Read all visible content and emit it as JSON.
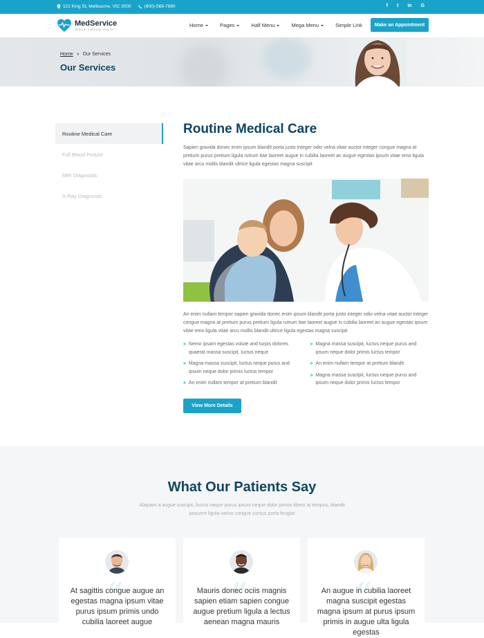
{
  "topbar": {
    "address": "121 King St, Melbourne, VIC 3000",
    "phone": "(800)-569-7890",
    "social": [
      "f",
      "t",
      "in",
      "G"
    ]
  },
  "logo": {
    "name": "MedService",
    "tagline": "MEDICAL & MEDICAL HEALTH"
  },
  "nav": {
    "items": [
      {
        "label": "Home",
        "dropdown": true
      },
      {
        "label": "Pages",
        "dropdown": true
      },
      {
        "label": "Half Menu",
        "dropdown": true
      },
      {
        "label": "Mega Menu",
        "dropdown": true
      },
      {
        "label": "Simple Link",
        "dropdown": false
      }
    ],
    "cta": "Make an Appointment"
  },
  "banner": {
    "breadcrumb_home": "Home",
    "breadcrumb_sep": "»",
    "breadcrumb_current": "Our Services",
    "title": "Our Services"
  },
  "sidebar": {
    "items": [
      {
        "label": "Routine Medical Care",
        "active": true
      },
      {
        "label": "Full Blood Picture",
        "active": false
      },
      {
        "label": "MRI Diagnostic",
        "active": false
      },
      {
        "label": "X-Ray Diagnostic",
        "active": false
      }
    ]
  },
  "service": {
    "title": "Routine Medical Care",
    "intro": "Sapien gravida donec enim ipsum blandit porta justo integer odio velna vitae auctor integer congue magna at pretium purus pretium ligula rutrum itae laoreet augue in cubilia laoreet an augue egestas ipsum vitae emo ligula vitae arcu mollis blandit ultrice ligula egestas magna suscipit",
    "body": "An enim nullam tempor sapien gravida donec enim ipsum blandit porta justo integer odio velna vitae auctor integer congue magna at pretium purus pretium ligula rutrum itae laoreet augue in cubilia laoreet an augue egestas ipsum vitae emo ligula vitae arcu mollis blandit ultrice ligula egestas magna suscipit",
    "bullets_left": [
      "Nemo ipsam egestas volute and turpis dolores quaerat massa suscipit, luctus neque",
      "Magna massa suscipit, luctus neque purus and ipsum neque dolor primis luctus tempor",
      "An enim nullam tempor at pretium blandit"
    ],
    "bullets_right": [
      "Magna massa suscipit, luctus neque purus and ipsum neque dolor primis luctus tempor",
      "An enim nullam tempor at pretium blandit",
      "Magna massa suscipit, luctus neque purus and ipsum neque dolor primis luctus tempor"
    ],
    "button": "View More Details"
  },
  "testimonials": {
    "title": "What Our Patients Say",
    "subtitle": "Aliquam a augue suscipit, luctus neque purus ipsum neque dolor primis libero at tempus, blandit posuere ligula varius congue cursus porta feugiat",
    "cards": [
      {
        "quote": "At sagittis congue augue an egestas magna ipsum vitae purus ipsum primis undo cubilia laoreet augue"
      },
      {
        "quote": "Mauris donec ociis magnis sapien etiam sapien congue augue pretium ligula a lectus aenean magna mauris"
      },
      {
        "quote": "An augue in cubilia laoreet magna suscipit egestas magna ipsum at purus ipsum primis in augue ulta ligula egestas"
      }
    ]
  },
  "colors": {
    "accent": "#1aa3c9",
    "heading": "#0e4560"
  }
}
